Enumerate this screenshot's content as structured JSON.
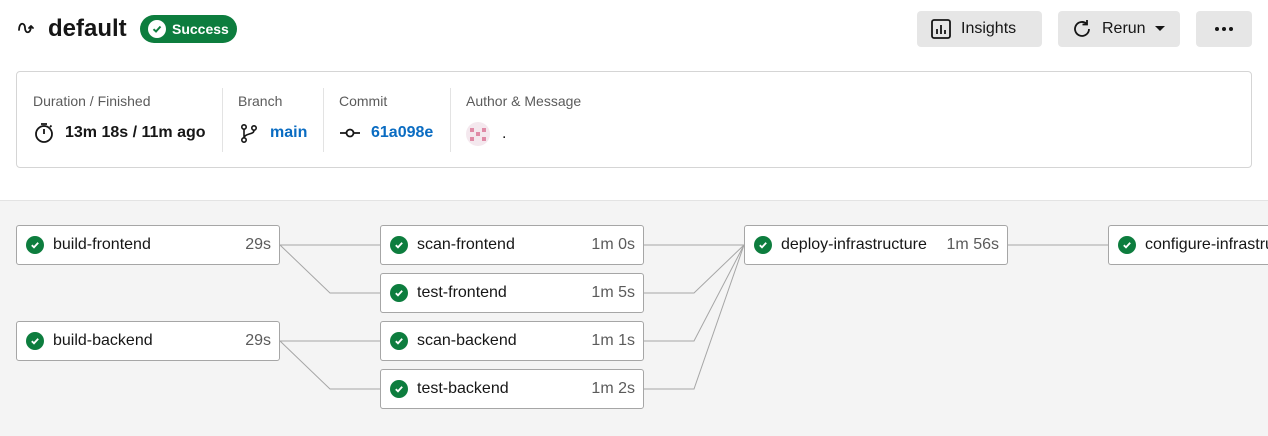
{
  "header": {
    "title": "default",
    "status": "Success",
    "insights_label": "Insights",
    "rerun_label": "Rerun",
    "more_label": "•••"
  },
  "info": {
    "duration": {
      "label": "Duration / Finished",
      "value": "13m 18s / 11m ago"
    },
    "branch": {
      "label": "Branch",
      "value": "main"
    },
    "commit": {
      "label": "Commit",
      "value": "61a098e"
    },
    "author": {
      "label": "Author & Message",
      "message": "."
    }
  },
  "jobs": [
    {
      "name": "build-frontend",
      "duration": "29s"
    },
    {
      "name": "build-backend",
      "duration": "29s"
    },
    {
      "name": "scan-frontend",
      "duration": "1m 0s"
    },
    {
      "name": "test-frontend",
      "duration": "1m 5s"
    },
    {
      "name": "scan-backend",
      "duration": "1m 1s"
    },
    {
      "name": "test-backend",
      "duration": "1m 2s"
    },
    {
      "name": "deploy-infrastructure",
      "duration": "1m 56s"
    },
    {
      "name": "configure-infrastructure",
      "duration": ""
    }
  ],
  "colors": {
    "success": "#0d7d3e",
    "link": "#0a6cc2"
  }
}
